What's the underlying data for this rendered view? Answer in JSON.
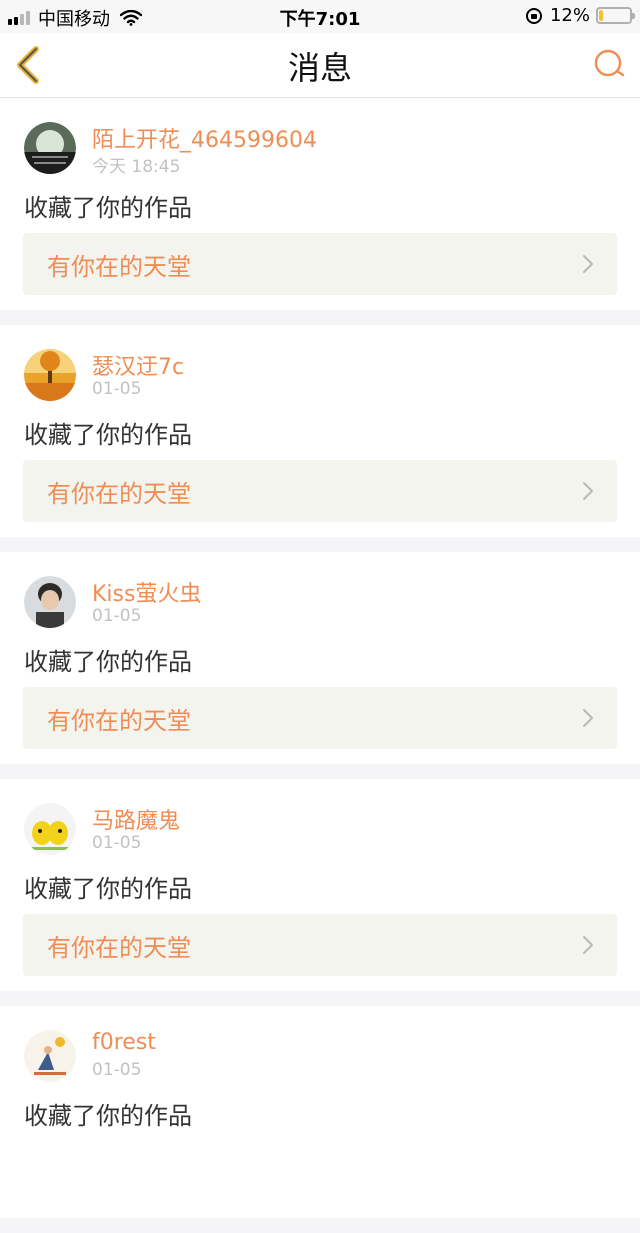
{
  "status_bar": {
    "carrier": "中国移动",
    "time": "下午7:01",
    "battery_percent": "12%",
    "battery_level": 0.12,
    "battery_color": "#f4c430"
  },
  "nav": {
    "title": "消息",
    "back_icon": "chevron-left-icon",
    "search_icon": "search-icon",
    "accent": "#ef8d55"
  },
  "messages": [
    {
      "username": "陌上开花_464599604",
      "time": "今天 18:45",
      "action": "收藏了你的作品",
      "work_title": "有你在的天堂"
    },
    {
      "username": "瑟汉迂7c",
      "time": "01-05",
      "action": "收藏了你的作品",
      "work_title": "有你在的天堂"
    },
    {
      "username": "Kiss萤火虫",
      "time": "01-05",
      "action": "收藏了你的作品",
      "work_title": "有你在的天堂"
    },
    {
      "username": "马路魔鬼",
      "time": "01-05",
      "action": "收藏了你的作品",
      "work_title": "有你在的天堂"
    },
    {
      "username": "f0rest",
      "time": "01-05",
      "action": "收藏了你的作品",
      "work_title": ""
    }
  ]
}
